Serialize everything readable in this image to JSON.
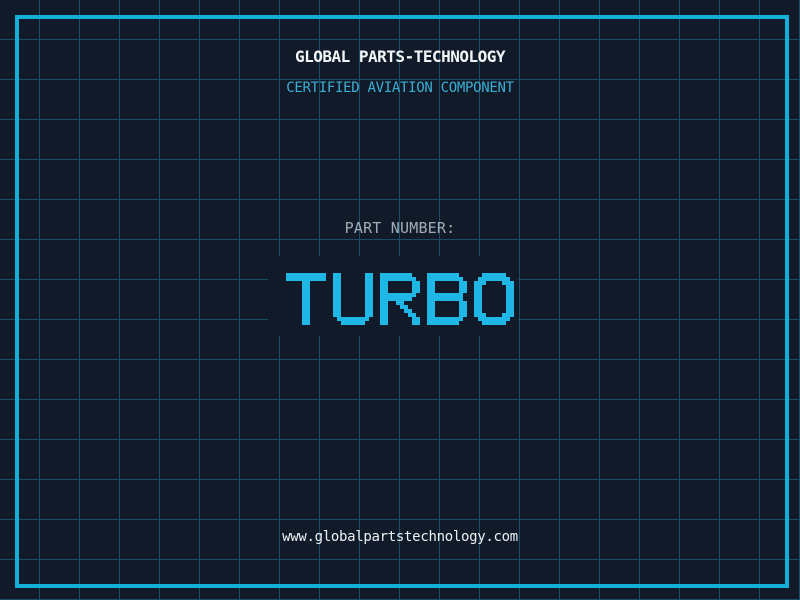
{
  "canvas": {
    "background_color": "#111a29",
    "grid_color": "#1c4e63",
    "frame_color": "#12b0d9"
  },
  "header": {
    "brand": "GLOBAL PARTS-TECHNOLOGY",
    "brand_color": "#f2f6f8",
    "tagline": "CERTIFIED AVIATION COMPONENT",
    "tagline_color": "#3aafd4"
  },
  "part": {
    "label": "PART NUMBER:",
    "label_color": "#9fadb9",
    "number": "TURBO",
    "number_color": "#1fb8e6"
  },
  "footer": {
    "website": "www.globalpartstechnology.com",
    "website_color": "#edf1f4"
  }
}
